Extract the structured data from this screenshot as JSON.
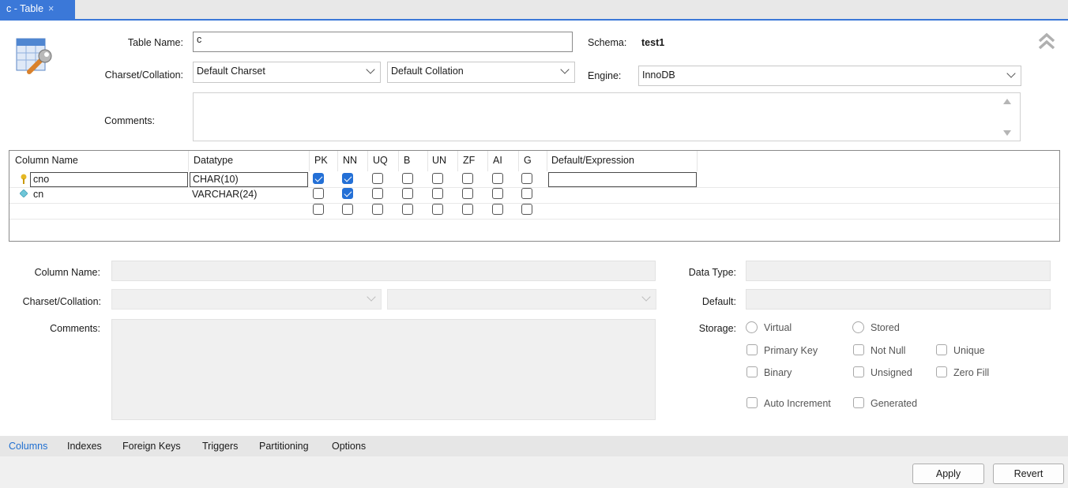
{
  "tab": {
    "title": "c - Table",
    "close": "×"
  },
  "table_name": {
    "label": "Table Name:",
    "value": "c"
  },
  "schema": {
    "label": "Schema:",
    "value": "test1"
  },
  "charset": {
    "label": "Charset/Collation:",
    "charset_value": "Default Charset",
    "collation_value": "Default Collation"
  },
  "engine": {
    "label": "Engine:",
    "value": "InnoDB"
  },
  "comments": {
    "label": "Comments:",
    "value": ""
  },
  "grid": {
    "headers": [
      "Column Name",
      "Datatype",
      "PK",
      "NN",
      "UQ",
      "B",
      "UN",
      "ZF",
      "AI",
      "G",
      "Default/Expression"
    ],
    "rows": [
      {
        "name": "cno",
        "datatype": "CHAR(10)",
        "icon": "primary-key-icon",
        "flags": [
          true,
          true,
          false,
          false,
          false,
          false,
          false,
          false
        ]
      },
      {
        "name": "cn",
        "datatype": "VARCHAR(24)",
        "icon": "column-diamond-icon",
        "flags": [
          false,
          true,
          false,
          false,
          false,
          false,
          false,
          false
        ]
      },
      {
        "name": "",
        "datatype": "",
        "icon": "",
        "flags": [
          false,
          false,
          false,
          false,
          false,
          false,
          false,
          false
        ]
      }
    ]
  },
  "details": {
    "column_name_label": "Column Name:",
    "charset_label": "Charset/Collation:",
    "comments_label": "Comments:",
    "data_type_label": "Data Type:",
    "default_label": "Default:",
    "storage_label": "Storage:",
    "virtual": "Virtual",
    "stored": "Stored",
    "primary_key": "Primary Key",
    "not_null": "Not Null",
    "unique": "Unique",
    "binary": "Binary",
    "unsigned": "Unsigned",
    "zero_fill": "Zero Fill",
    "auto_increment": "Auto Increment",
    "generated": "Generated"
  },
  "bottom_tabs": [
    "Columns",
    "Indexes",
    "Foreign Keys",
    "Triggers",
    "Partitioning",
    "Options"
  ],
  "buttons": {
    "apply": "Apply",
    "revert": "Revert"
  },
  "colors": {
    "accent": "#3b78d8",
    "check": "#2470d6",
    "active_tab": "#1f6fd1"
  }
}
